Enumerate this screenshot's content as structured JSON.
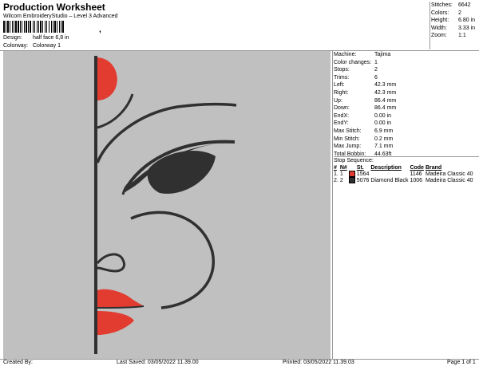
{
  "header": {
    "title": "Production Worksheet",
    "subtitle": "Wilcom EmbroideryStudio – Level 3 Advanced",
    "barcode_suffix": ","
  },
  "design": {
    "design_label": "Design:",
    "design_value": "half face 6,8 in",
    "colorway_label": "Colorway:",
    "colorway_value": "Colorway 1"
  },
  "summary": {
    "stitches_label": "Stitches:",
    "stitches_value": "6642",
    "colors_label": "Colors:",
    "colors_value": "2",
    "height_label": "Height:",
    "height_value": "6.80 in",
    "width_label": "Width:",
    "width_value": "3.33 in",
    "zoom_label": "Zoom:",
    "zoom_value": "1:1"
  },
  "properties": [
    {
      "label": "Machine:",
      "value": "Tajima"
    },
    {
      "label": "Color changes:",
      "value": "1"
    },
    {
      "label": "Stops:",
      "value": "2"
    },
    {
      "label": "Trims:",
      "value": "6"
    },
    {
      "label": "Left:",
      "value": "42.3 mm"
    },
    {
      "label": "Right:",
      "value": "42.3 mm"
    },
    {
      "label": "Up:",
      "value": "86.4 mm"
    },
    {
      "label": "Down:",
      "value": "86.4 mm"
    },
    {
      "label": "EndX:",
      "value": "0.00 in"
    },
    {
      "label": "EndY:",
      "value": "0.00 in"
    },
    {
      "label": "Max Stitch:",
      "value": "6.9 mm"
    },
    {
      "label": "Min Stitch:",
      "value": "0.2 mm"
    },
    {
      "label": "Max Jump:",
      "value": "7.1 mm"
    },
    {
      "label": "Total Bobbin:",
      "value": "44.63ft"
    }
  ],
  "stop_sequence": {
    "heading": "Stop Sequence:",
    "columns": [
      "#",
      "N#",
      "",
      "St.",
      "Description",
      "Code",
      "Brand"
    ],
    "rows": [
      {
        "num": "1.",
        "n": "1",
        "color": "#e23b30",
        "st": "1564",
        "description": "",
        "code": "1146",
        "brand": "Madeira Classic 40"
      },
      {
        "num": "2.",
        "n": "2",
        "color": "#303030",
        "st": "5076",
        "description": "Diamond Black",
        "code": "1006",
        "brand": "Madeira Classic 40"
      }
    ]
  },
  "footer": {
    "created_by": "Created By:",
    "last_saved": "Last Saved: 03/05/2022 11.39.00",
    "printed": "Printed: 03/05/2022 11.39.03",
    "page": "Page 1 of 1"
  },
  "colors": {
    "canvas_bg": "#c0c0c0",
    "thread_red": "#e23b30",
    "thread_black": "#303030"
  }
}
